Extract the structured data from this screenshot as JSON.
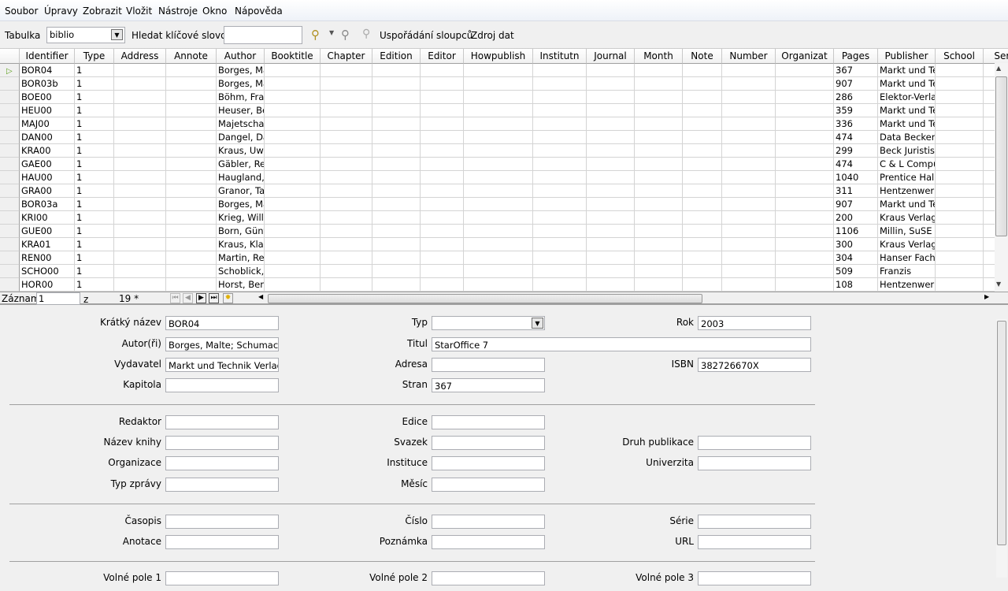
{
  "menu": [
    "Soubor",
    "Úpravy",
    "Zobrazit",
    "Vložit",
    "Nástroje",
    "Okno",
    "Nápověda"
  ],
  "toolbar": {
    "table_label": "Tabulka",
    "table_value": "biblio",
    "search_label": "Hledat klíčové slovo",
    "search_value": "",
    "column_arrangement": "Uspořádání sloupců",
    "data_source": "Zdroj dat"
  },
  "columns": [
    "Identifier",
    "Type",
    "Address",
    "Annote",
    "Author",
    "Booktitle",
    "Chapter",
    "Edition",
    "Editor",
    "Howpublish",
    "Institutn",
    "Journal",
    "Month",
    "Note",
    "Number",
    "Organizat",
    "Pages",
    "Publisher",
    "School",
    "Seri"
  ],
  "rows": [
    [
      "BOR04",
      "1",
      "Borges, Ma",
      "367",
      "Markt und Te"
    ],
    [
      "BOR03b",
      "1",
      "Borges, Ma",
      "907",
      "Markt und Te"
    ],
    [
      "BOE00",
      "1",
      "Böhm, Fran",
      "286",
      "Elektor-Verlag"
    ],
    [
      "HEU00",
      "1",
      "Heuser, Be",
      "359",
      "Markt und Te"
    ],
    [
      "MAJ00",
      "1",
      "Majetschak",
      "336",
      "Markt und Te"
    ],
    [
      "DAN00",
      "1",
      "Dangel, Da",
      "474",
      "Data Becker"
    ],
    [
      "KRA00",
      "1",
      "Kraus, Uwe",
      "299",
      "Beck Juristisc"
    ],
    [
      "GAE00",
      "1",
      "Gäbler, Rer",
      "474",
      "C & L Compu"
    ],
    [
      "HAU00",
      "1",
      "Haugland,",
      "1040",
      "Prentice Hall"
    ],
    [
      "GRA00",
      "1",
      "Granor, Tar",
      "311",
      "Hentzenwerk"
    ],
    [
      "BOR03a",
      "1",
      "Borges, Ma",
      "907",
      "Markt und Te"
    ],
    [
      "KRI00",
      "1",
      "Krieg, Willy",
      "200",
      "Kraus Verlag"
    ],
    [
      "GUE00",
      "1",
      "Born, Günt",
      "1106",
      "Millin, SuSE L"
    ],
    [
      "KRA01",
      "1",
      "Kraus, Klau",
      "300",
      "Kraus Verlag"
    ],
    [
      "REN00",
      "1",
      "Martin, Rer",
      "304",
      "Hanser Fachb"
    ],
    [
      "SCHO00",
      "1",
      "Schoblick,",
      "509",
      "Franzis"
    ],
    [
      "HOR00",
      "1",
      "Horst, Ben",
      "108",
      "Hentzenwerk"
    ]
  ],
  "nav": {
    "record_label": "Záznam",
    "record_value": "1",
    "of_label": "z",
    "total": "19 *"
  },
  "form": {
    "kratky_nazev": {
      "label": "Krátký název",
      "value": "BOR04"
    },
    "autori": {
      "label": "Autor(ři)",
      "value": "Borges, Malte; Schumacher"
    },
    "vydavatel": {
      "label": "Vydavatel",
      "value": "Markt und Technik Verlag"
    },
    "kapitola": {
      "label": "Kapitola",
      "value": ""
    },
    "typ": {
      "label": "Typ",
      "value": ""
    },
    "titul": {
      "label": "Titul",
      "value": "StarOffice 7"
    },
    "adresa": {
      "label": "Adresa",
      "value": ""
    },
    "stran": {
      "label": "Stran",
      "value": "367"
    },
    "rok": {
      "label": "Rok",
      "value": "2003"
    },
    "isbn": {
      "label": "ISBN",
      "value": "382726670X"
    },
    "redaktor": {
      "label": "Redaktor",
      "value": ""
    },
    "nazev_knihy": {
      "label": "Název knihy",
      "value": ""
    },
    "organizace": {
      "label": "Organizace",
      "value": ""
    },
    "typ_zpravy": {
      "label": "Typ zprávy",
      "value": ""
    },
    "edice": {
      "label": "Edice",
      "value": ""
    },
    "svazek": {
      "label": "Svazek",
      "value": ""
    },
    "instituce": {
      "label": "Instituce",
      "value": ""
    },
    "mesic": {
      "label": "Měsíc",
      "value": ""
    },
    "druh_publikace": {
      "label": "Druh publikace",
      "value": ""
    },
    "univerzita": {
      "label": "Univerzita",
      "value": ""
    },
    "casopis": {
      "label": "Časopis",
      "value": ""
    },
    "anotace": {
      "label": "Anotace",
      "value": ""
    },
    "cislo": {
      "label": "Číslo",
      "value": ""
    },
    "poznamka": {
      "label": "Poznámka",
      "value": ""
    },
    "serie": {
      "label": "Série",
      "value": ""
    },
    "url": {
      "label": "URL",
      "value": ""
    },
    "volne1": {
      "label": "Volné pole 1",
      "value": ""
    },
    "volne2": {
      "label": "Volné pole 2",
      "value": ""
    },
    "volne3": {
      "label": "Volné pole 3",
      "value": ""
    }
  }
}
